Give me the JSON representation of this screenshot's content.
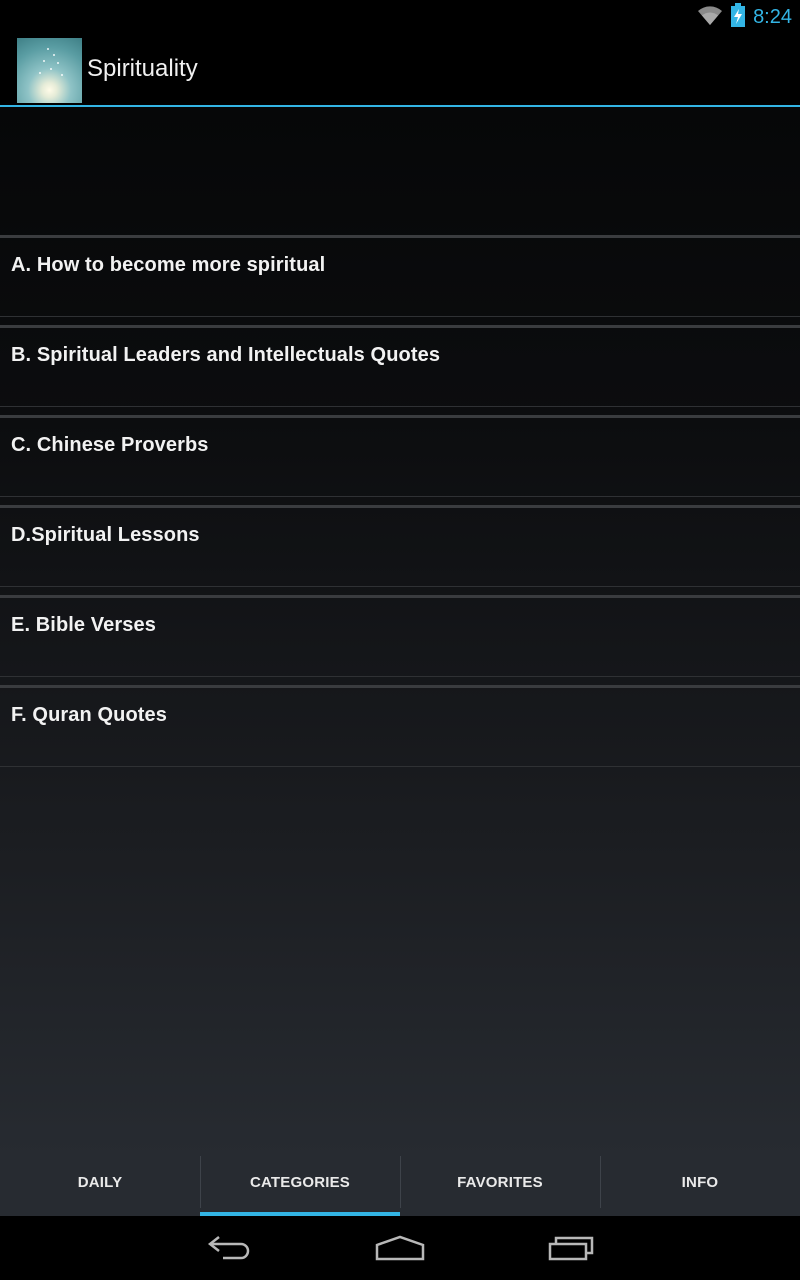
{
  "status_bar": {
    "time": "8:24",
    "icons": [
      "wifi-icon",
      "battery-charging-icon"
    ],
    "accent_color": "#33b5e5"
  },
  "action_bar": {
    "title": "Spirituality",
    "icon": "lotus-app-icon"
  },
  "categories": [
    {
      "label": "A. How to become more spiritual"
    },
    {
      "label": "B. Spiritual Leaders and Intellectuals Quotes"
    },
    {
      "label": "C. Chinese Proverbs"
    },
    {
      "label": "D.Spiritual Lessons"
    },
    {
      "label": "E. Bible Verses"
    },
    {
      "label": "F. Quran Quotes"
    }
  ],
  "tabs": [
    {
      "label": "DAILY",
      "selected": false
    },
    {
      "label": "CATEGORIES",
      "selected": true
    },
    {
      "label": "FAVORITES",
      "selected": false
    },
    {
      "label": "INFO",
      "selected": false
    }
  ],
  "nav_bar": {
    "buttons": [
      "back-icon",
      "home-icon",
      "recent-apps-icon"
    ]
  }
}
